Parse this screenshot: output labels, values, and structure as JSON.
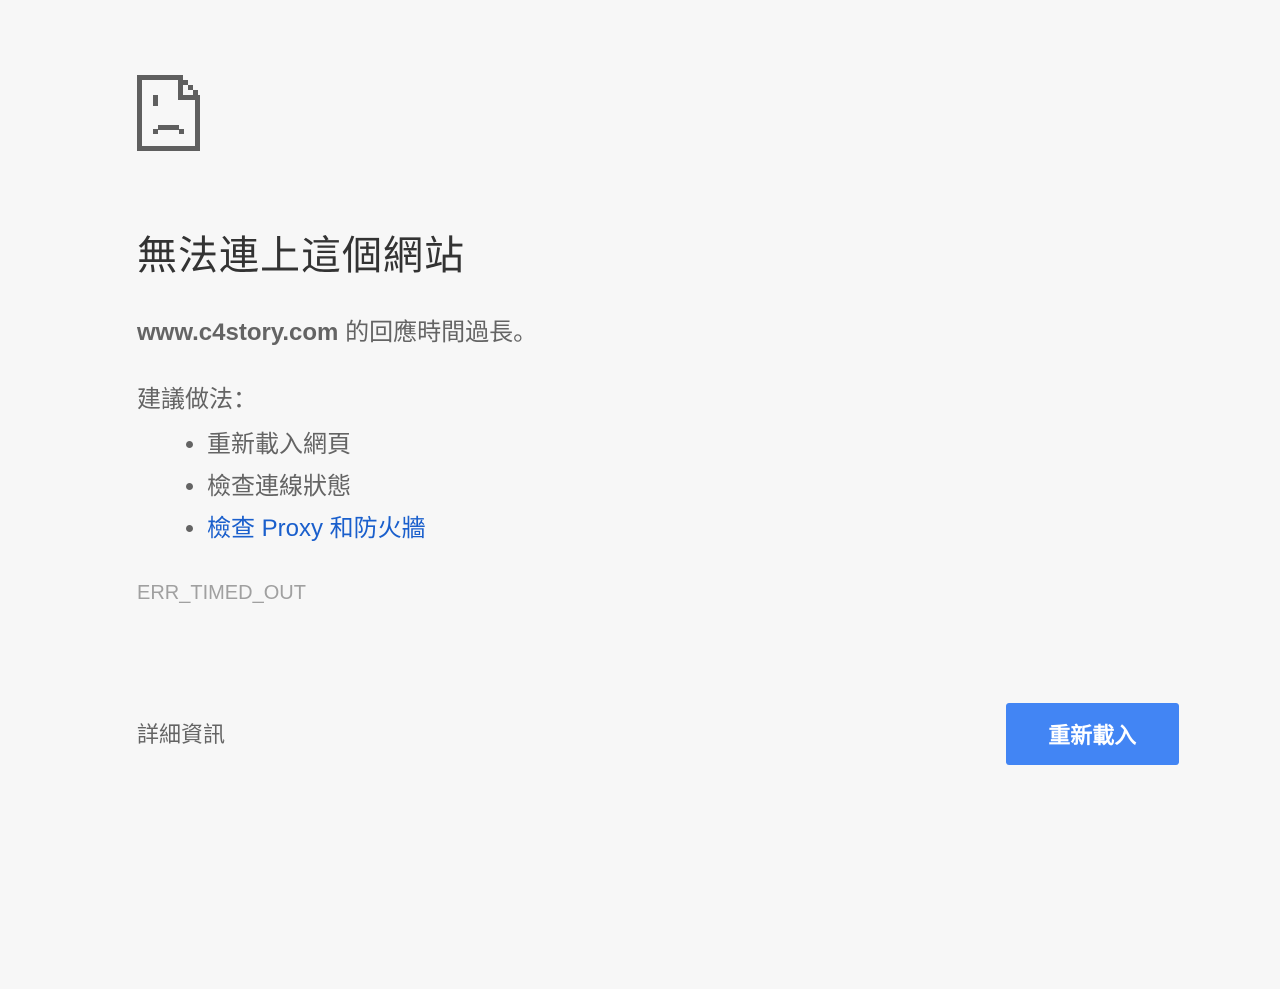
{
  "error": {
    "icon": "sad-page-icon",
    "title": "無法連上這個網站",
    "host": "www.c4story.com",
    "summary_suffix": " 的回應時間過長。",
    "suggestions_title": "建議做法：",
    "suggestions": [
      {
        "label": "重新載入網頁"
      },
      {
        "label": "檢查連線狀態"
      },
      {
        "label": "檢查 Proxy 和防火牆",
        "link": true
      }
    ],
    "code": "ERR_TIMED_OUT"
  },
  "buttons": {
    "details": "詳細資訊",
    "reload": "重新載入"
  },
  "colors": {
    "background": "#f7f7f7",
    "accent": "#4285f4",
    "link": "#1a5fcc"
  }
}
